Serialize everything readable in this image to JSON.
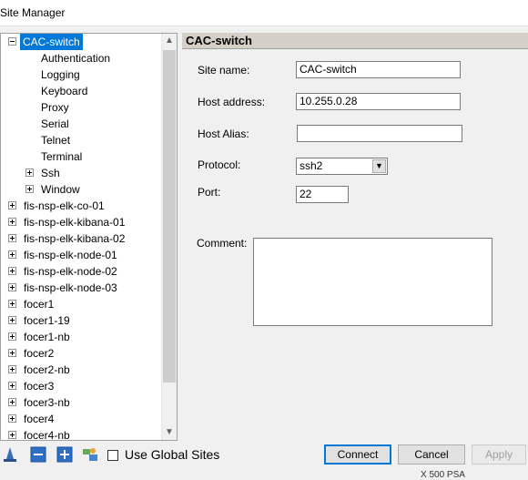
{
  "window": {
    "title": "Site Manager"
  },
  "tree": {
    "selected": "CAC-switch",
    "children": [
      "Authentication",
      "Logging",
      "Keyboard",
      "Proxy",
      "Serial",
      "Telnet",
      "Terminal",
      "Ssh",
      "Window"
    ],
    "sites": [
      "fis-nsp-elk-co-01",
      "fis-nsp-elk-kibana-01",
      "fis-nsp-elk-kibana-02",
      "fis-nsp-elk-node-01",
      "fis-nsp-elk-node-02",
      "fis-nsp-elk-node-03",
      "focer1",
      "focer1-19",
      "focer1-nb",
      "focer2",
      "focer2-nb",
      "focer3",
      "focer3-nb",
      "focer4",
      "focer4-nb"
    ]
  },
  "form": {
    "header": "CAC-switch",
    "site_name_label": "Site name:",
    "site_name_value": "CAC-switch",
    "host_address_label": "Host address:",
    "host_address_value": "10.255.0.28",
    "host_alias_label": "Host Alias:",
    "host_alias_value": "",
    "protocol_label": "Protocol:",
    "protocol_value": "ssh2",
    "port_label": "Port:",
    "port_value": "22",
    "comment_label": "Comment:"
  },
  "bottom": {
    "use_global_sites": "Use Global Sites",
    "connect": "Connect",
    "cancel": "Cancel",
    "apply": "Apply"
  },
  "status_fragment": "X 500  PSA"
}
